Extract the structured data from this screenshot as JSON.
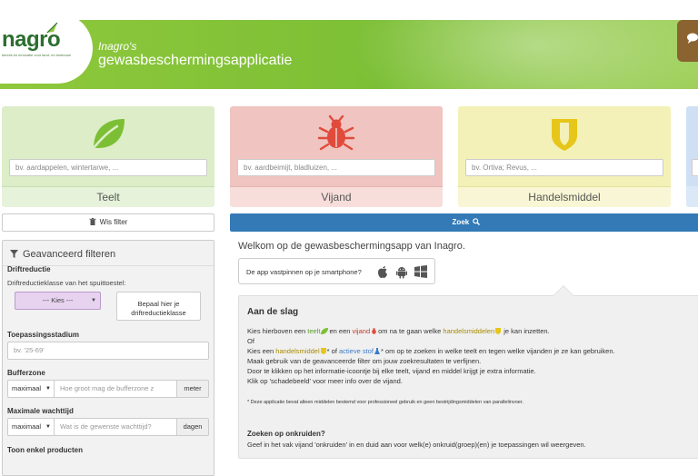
{
  "header": {
    "logo": "nagro",
    "logo_tagline": "kennis en innovatie voor land- en tuinbouw",
    "subtitle": "Inagro's",
    "title": "gewasbeschermingsapplicatie"
  },
  "categories": [
    {
      "label": "Teelt",
      "placeholder": "bv. aardappelen, wintertarwe, ...",
      "icon": "leaf-icon",
      "color": "#7cbf35"
    },
    {
      "label": "Vijand",
      "placeholder": "bv. aardbeimijt, bladluizen, ...",
      "icon": "bug-icon",
      "color": "#e04b3c"
    },
    {
      "label": "Handelsmiddel",
      "placeholder": "bv. Ortiva; Revus, ...",
      "icon": "shield-icon",
      "color": "#e6c619"
    }
  ],
  "actions": {
    "wis_filter": "Wis filter",
    "zoek": "Zoek"
  },
  "filter": {
    "title": "Geavanceerd filteren",
    "drift": {
      "label": "Driftreductie",
      "sublabel": "Driftreductieklasse van het spuittoestel:",
      "select": "--- Kies ---",
      "button_line1": "Bepaal hier je",
      "button_line2": "driftreductieklasse"
    },
    "stadium": {
      "label": "Toepassingsstadium",
      "placeholder": "bv. '25-69'"
    },
    "bufferzone": {
      "label": "Bufferzone",
      "select": "maximaal",
      "placeholder": "Hoe groot mag de bufferzone z",
      "unit": "meter"
    },
    "wachttijd": {
      "label": "Maximale wachttijd",
      "select": "maximaal",
      "placeholder": "Wat is de gewenste wachttijd?",
      "unit": "dagen"
    },
    "enkel": {
      "label": "Toon enkel producten"
    }
  },
  "main": {
    "welcome": "Welkom op de gewasbeschermingsapp van Inagro.",
    "pin_text": "De app vastpinnen op je smartphone?",
    "slag": {
      "title": "Aan de slag",
      "l1a": "Kies hierboven een ",
      "l1b": "teelt",
      "l1c": "en een ",
      "l1d": "vijand",
      "l1e": "om na te gaan welke ",
      "l1f": "handelsmiddelen",
      "l1g": " je kan inzetten.",
      "l2": "Of",
      "l3a": "Kies een ",
      "l3b": "handelsmiddel",
      "l3c": "* of ",
      "l3d": "actieve stof",
      "l3e": "* om op te zoeken in welke teelt en tegen welke vijanden je ze kan gebruiken.",
      "l4": "Maak gebruik van de geavanceerde filter om jouw zoekresultaten te verfijnen.",
      "l5": "Door te klikken op het informatie-icoontje bij elke teelt, vijand en middel krijgt je extra informatie.",
      "l6": "Klik op 'schadebeeld' voor meer info over de vijand.",
      "note": "* Deze applicatie bevat alleen middelen bestemd voor professioneel gebruik en geen bestrijdingsmiddelen van parallelinvoer.",
      "h_onkruid": "Zoeken op onkruiden?",
      "onkruid": "Geef in het vak vijand 'onkruiden' in en duid aan voor welk(e) onkruid(groep)(en) je toepassingen wil weergeven."
    }
  }
}
